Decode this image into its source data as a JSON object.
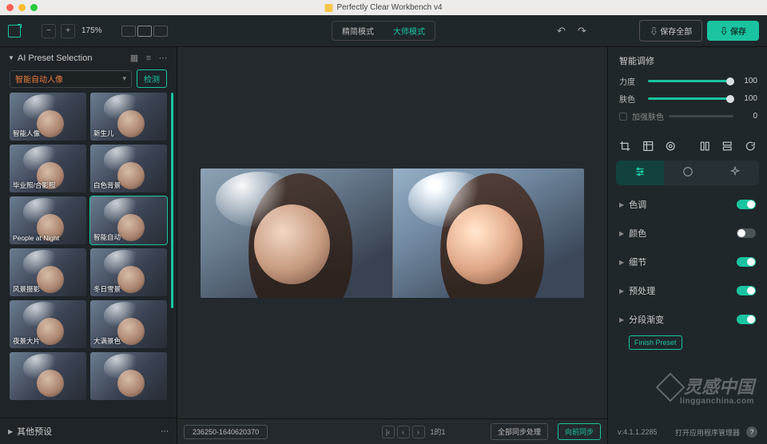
{
  "app": {
    "title": "Perfectly Clear Workbench v4"
  },
  "toolbar": {
    "minus": "−",
    "plus": "+",
    "zoom": "175%",
    "mode_simple": "精简模式",
    "mode_master": "大师模式",
    "save_all": "⇩ 保存全部",
    "save": "⇩ 保存"
  },
  "left": {
    "title": "AI Preset Selection",
    "selected_preset": "智能自动人像",
    "detect": "检测",
    "other_presets": "其他预设",
    "presets": [
      {
        "label": "智能人像"
      },
      {
        "label": "新生儿"
      },
      {
        "label": "毕业照/合影照"
      },
      {
        "label": "白色背景"
      },
      {
        "label": "People at Night"
      },
      {
        "label": "智能自动"
      },
      {
        "label": "风景摄影"
      },
      {
        "label": "冬日雪景"
      },
      {
        "label": "夜景大片"
      },
      {
        "label": "大满景色"
      },
      {
        "label": ""
      },
      {
        "label": ""
      }
    ]
  },
  "center": {
    "filename": "236250-1640620370",
    "page_info": "1的1",
    "sync": "全部同步处理",
    "sync2": "向前同步"
  },
  "right": {
    "title": "智能调修",
    "s1_label": "力度",
    "s1_val": "100",
    "s2_label": "肤色",
    "s2_val": "100",
    "chk_label": "加强肤色",
    "chk_val": "0",
    "acc": [
      {
        "name": "色调",
        "on": true
      },
      {
        "name": "颜色",
        "on": false
      },
      {
        "name": "细节",
        "on": true
      },
      {
        "name": "预处理",
        "on": true
      },
      {
        "name": "分段渐变",
        "on": true
      }
    ],
    "finish": "Finish Preset",
    "version": "v:4.1.1.2285",
    "mgr": "打开应用程序管理器"
  },
  "wm": {
    "big": "灵感中国",
    "small": "lingganchina.com"
  }
}
